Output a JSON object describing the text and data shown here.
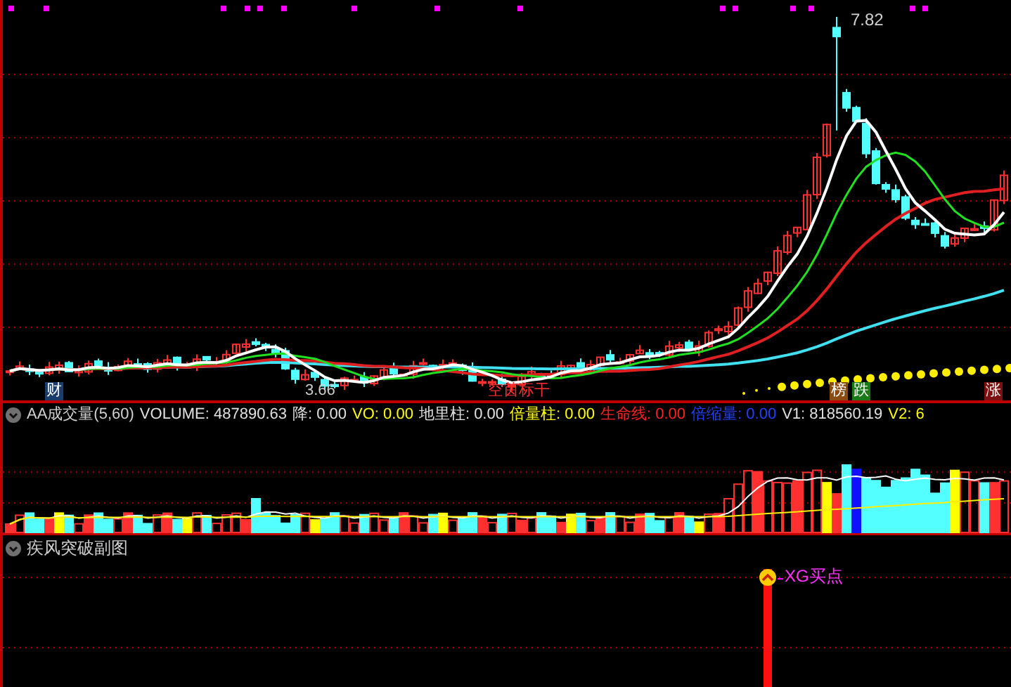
{
  "main_chart": {
    "high_label": "7.82",
    "low_label": "3.66",
    "annotation": "空茵标干",
    "tags": [
      {
        "label": "财",
        "color": "#1a3d6e"
      },
      {
        "label": "榜",
        "color": "#8a4a10"
      },
      {
        "label": "跌",
        "color": "#1a7a1a"
      },
      {
        "label": "涨",
        "color": "#7a1010"
      }
    ]
  },
  "volume_panel": {
    "title": "AA成交量(5,60)",
    "fields": [
      {
        "label": "VOLUME:",
        "value": "487890.63",
        "color": "#e0e0e0"
      },
      {
        "label": "降:",
        "value": "0.00",
        "color": "#e0e0e0"
      },
      {
        "label": "VO:",
        "value": "0.00",
        "color": "#ffff00"
      },
      {
        "label": "地里柱:",
        "value": "0.00",
        "color": "#e0e0e0"
      },
      {
        "label": "倍量柱:",
        "value": "0.00",
        "color": "#ffff00"
      },
      {
        "label": "生命线:",
        "value": "0.00",
        "color": "#ff2020"
      },
      {
        "label": "倍缩量:",
        "value": "0.00",
        "color": "#2040ff"
      },
      {
        "label": "V1:",
        "value": "818560.19",
        "color": "#e0e0e0"
      },
      {
        "label": "V2:",
        "value": "6",
        "color": "#ffff00"
      }
    ]
  },
  "signal_panel": {
    "title": "疾风突破副图",
    "signal": "XG买点"
  }
}
